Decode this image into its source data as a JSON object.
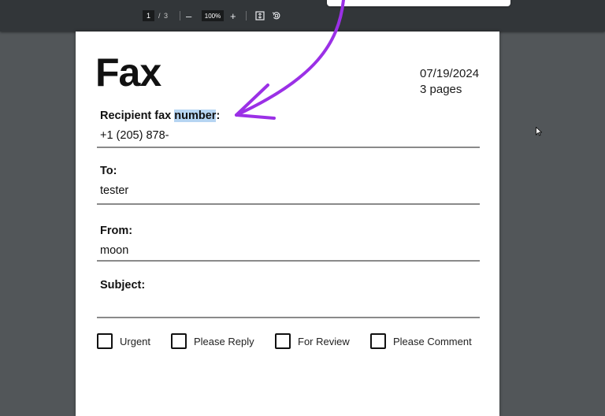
{
  "toolbar": {
    "current_page": "1",
    "page_separator": "/",
    "total_pages": "3",
    "zoom_out": "–",
    "zoom_level": "100%",
    "zoom_in": "+"
  },
  "document": {
    "title": "Fax",
    "date": "07/19/2024",
    "pages": "3 pages",
    "recipient_label_main": "Recipient fax ",
    "recipient_label_highlight": "number",
    "recipient_label_colon": ":",
    "recipient_value": "+1 (205) 878-",
    "to_label": "To:",
    "to_value": "tester",
    "from_label": "From:",
    "from_value": "moon",
    "subject_label": "Subject:",
    "subject_value": "",
    "checkboxes": [
      "Urgent",
      "Please Reply",
      "For Review",
      "Please Comment"
    ]
  },
  "colors": {
    "viewer_bg": "#525659",
    "toolbar_bg": "#323639",
    "annotation_arrow": "#9b30e6",
    "text_highlight": "#b6d5f2"
  }
}
